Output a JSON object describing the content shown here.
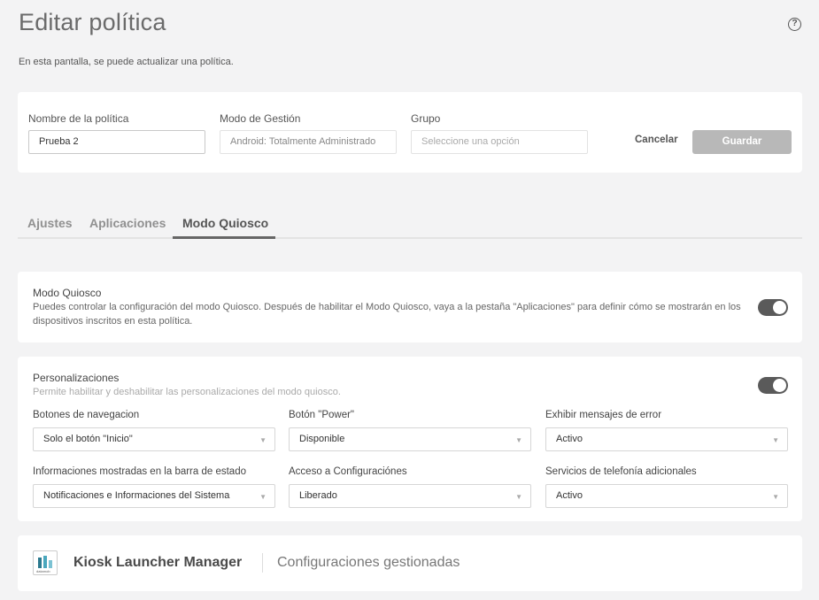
{
  "page": {
    "title": "Editar política",
    "help_icon": "question-circle-icon",
    "subtitle": "En esta pantalla, se puede actualizar una política."
  },
  "form": {
    "name_label": "Nombre de la política",
    "name_value": "Prueba 2",
    "mode_label": "Modo de Gestión",
    "mode_value": "Android: Totalmente Administrado",
    "group_label": "Grupo",
    "group_placeholder": "Seleccione una opción",
    "cancel_label": "Cancelar",
    "save_label": "Guardar"
  },
  "tabs": [
    {
      "label": "Ajustes"
    },
    {
      "label": "Aplicaciones"
    },
    {
      "label": "Modo Quiosco",
      "active": true
    }
  ],
  "kiosk": {
    "title": "Modo Quiosco",
    "description": "Puedes controlar la configuración del modo Quiosco. Después de habilitar el Modo Quiosco, vaya a la pestaña \"Aplicaciones\" para definir cómo se mostrarán en los dispositivos inscritos en esta política.",
    "enabled": true
  },
  "customizations": {
    "title": "Personalizaciones",
    "description": "Permite habilitar y deshabilitar las personalizaciones del modo quiosco.",
    "enabled": true,
    "fields": [
      {
        "label": "Botones de navegacion",
        "value": "Solo el botón \"Inicio\""
      },
      {
        "label": "Botón \"Power\"",
        "value": "Disponible"
      },
      {
        "label": "Exhibir mensajes de error",
        "value": "Activo"
      },
      {
        "label": "Informaciones mostradas en la barra de estado",
        "value": "Notificaciones e Informaciones del Sistema"
      },
      {
        "label": "Acceso a Configuraciónes",
        "value": "Liberado"
      },
      {
        "label": "Servicios de telefonía adicionales",
        "value": "Activo"
      }
    ]
  },
  "app": {
    "name": "Kiosk Launcher Manager",
    "subtitle": "Configuraciones gestionadas",
    "logo_text": "datamob"
  },
  "colors": {
    "toggle_on": "#5a5a5a",
    "save_disabled": "#b8b8b8",
    "background": "#f3f3f4"
  }
}
